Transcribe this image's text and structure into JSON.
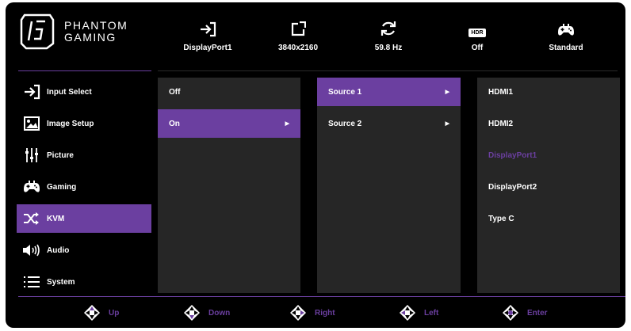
{
  "brand": {
    "line1": "PHANTOM",
    "line2": "GAMING"
  },
  "status": [
    {
      "icon": "input-icon",
      "label": "DisplayPort1"
    },
    {
      "icon": "resolution-icon",
      "label": "3840x2160"
    },
    {
      "icon": "refresh-icon",
      "label": "59.8 Hz"
    },
    {
      "icon": "hdr-icon",
      "badge": "HDR",
      "label": "Off"
    },
    {
      "icon": "gamepad-icon",
      "label": "Standard"
    }
  ],
  "menu": [
    {
      "label": "Input Select",
      "icon": "input-select-icon"
    },
    {
      "label": "Image Setup",
      "icon": "image-setup-icon"
    },
    {
      "label": "Picture",
      "icon": "picture-sliders-icon"
    },
    {
      "label": "Gaming",
      "icon": "gaming-icon"
    },
    {
      "label": "KVM",
      "icon": "kvm-shuffle-icon",
      "selected": true
    },
    {
      "label": "Audio",
      "icon": "speaker-icon"
    },
    {
      "label": "System",
      "icon": "system-list-icon"
    }
  ],
  "kvm_options": [
    {
      "label": "Off"
    },
    {
      "label": "On",
      "selected": true
    }
  ],
  "sources": [
    {
      "label": "Source 1",
      "selected": true
    },
    {
      "label": "Source 2"
    }
  ],
  "inputs": [
    {
      "label": "HDMI1"
    },
    {
      "label": "HDMI2"
    },
    {
      "label": "DisplayPort1",
      "highlighted": true
    },
    {
      "label": "DisplayPort2"
    },
    {
      "label": "Type C"
    }
  ],
  "hints": [
    {
      "label": "Up"
    },
    {
      "label": "Down"
    },
    {
      "label": "Right"
    },
    {
      "label": "Left"
    },
    {
      "label": "Enter"
    }
  ],
  "colors": {
    "accent": "#6b3fa0",
    "panel": "#262626",
    "background": "#000000"
  }
}
